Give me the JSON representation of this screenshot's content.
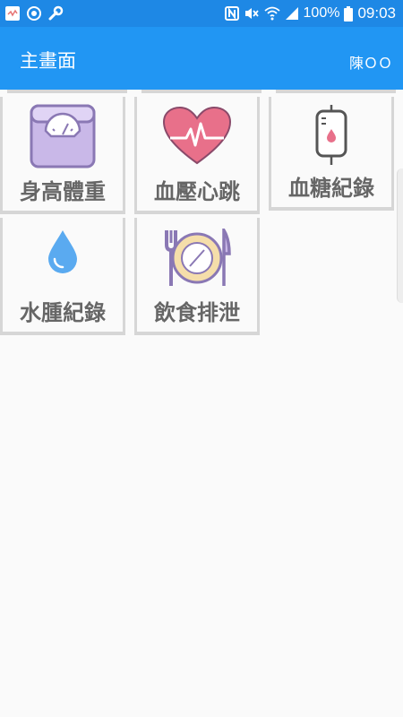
{
  "status_bar": {
    "battery_percent": "100%",
    "time": "09:03",
    "icons": [
      "app-icon",
      "sync-icon",
      "wrench-icon",
      "nfc-icon",
      "mute-icon",
      "wifi-icon",
      "signal-icon",
      "battery-icon"
    ]
  },
  "app_bar": {
    "title": "主畫面",
    "user": "陳ＯＯ",
    "color": "#2196f3"
  },
  "menu": {
    "items": [
      {
        "label": "身高體重",
        "icon": "scale-icon"
      },
      {
        "label": "血壓心跳",
        "icon": "heart-icon"
      },
      {
        "label": "血糖紀錄",
        "icon": "blood-bag-icon"
      },
      {
        "label": "水腫紀錄",
        "icon": "water-drop-icon"
      },
      {
        "label": "飲食排泄",
        "icon": "plate-icon"
      }
    ]
  }
}
